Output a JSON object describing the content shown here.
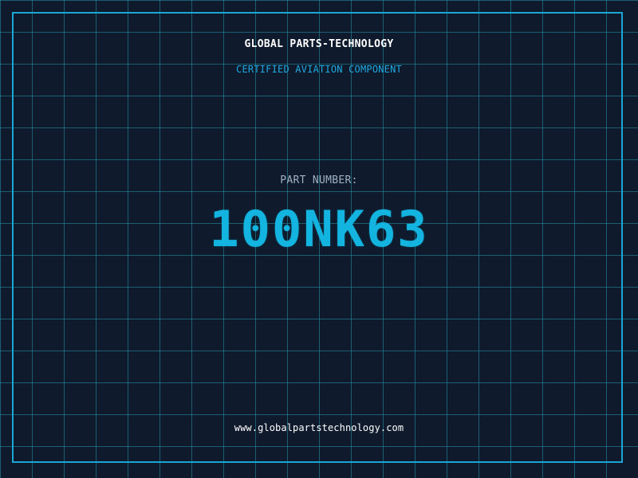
{
  "header": {
    "company_name": "GLOBAL PARTS-TECHNOLOGY",
    "subtitle": "CERTIFIED AVIATION COMPONENT"
  },
  "part": {
    "label": "PART NUMBER:",
    "number": "100NK63"
  },
  "footer": {
    "website": "www.globalpartstechnology.com"
  },
  "colors": {
    "background": "#0f1b2d",
    "grid": "#2296aa",
    "frame": "#1aa7d6",
    "accent": "#13b5e0",
    "label": "#9fb0c3"
  }
}
